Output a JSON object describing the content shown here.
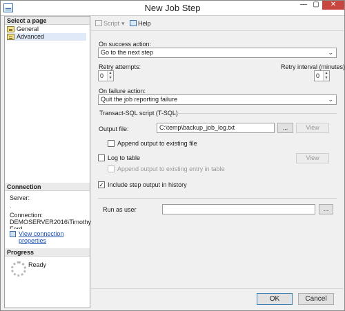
{
  "window": {
    "title": "New Job Step",
    "controls": {
      "minimize": "—",
      "maximize": "▢",
      "close": "✕"
    }
  },
  "sidebar": {
    "select_page_header": "Select a page",
    "pages": [
      {
        "label": "General",
        "icon": "page-icon"
      },
      {
        "label": "Advanced",
        "icon": "page-icon"
      }
    ],
    "connection_header": "Connection",
    "server_label": "Server:",
    "server_value": ".",
    "connection_label": "Connection:",
    "connection_value": "DEMOSERVER2016\\Timothy",
    "connection_value_cut": "Ford",
    "view_connection_link": "View connection properties",
    "progress_header": "Progress",
    "progress_status": "Ready"
  },
  "toolbar": {
    "script_label": "Script",
    "script_dropdown": "▾",
    "help_label": "Help"
  },
  "form": {
    "on_success_label": "On success action:",
    "on_success_value": "Go to the next step",
    "retry_attempts_label": "Retry attempts:",
    "retry_attempts_value": "0",
    "retry_interval_label": "Retry interval (minutes):",
    "retry_interval_value": "0",
    "on_failure_label": "On failure action:",
    "on_failure_value": "Quit the job reporting failure",
    "tsql_group_label": "Transact-SQL script (T-SQL)",
    "output_file_label": "Output file:",
    "output_file_value": "C:\\temp\\backup_job_log.txt",
    "browse_label": "...",
    "view_label": "View",
    "append_output_label": "Append output to existing file",
    "append_output_checked": false,
    "log_to_table_label": "Log to table",
    "log_to_table_checked": false,
    "view_table_label": "View",
    "append_table_label": "Append output to existing entry in table",
    "append_table_checked": false,
    "include_history_label": "Include step output in history",
    "include_history_checked": true,
    "run_as_user_label": "Run as user",
    "run_as_user_value": "",
    "run_as_browse_label": "..."
  },
  "footer": {
    "ok_label": "OK",
    "cancel_label": "Cancel"
  },
  "colors": {
    "close_button": "#c7463f",
    "link": "#1a4fb0",
    "selected_page": "#dfe9f7"
  }
}
